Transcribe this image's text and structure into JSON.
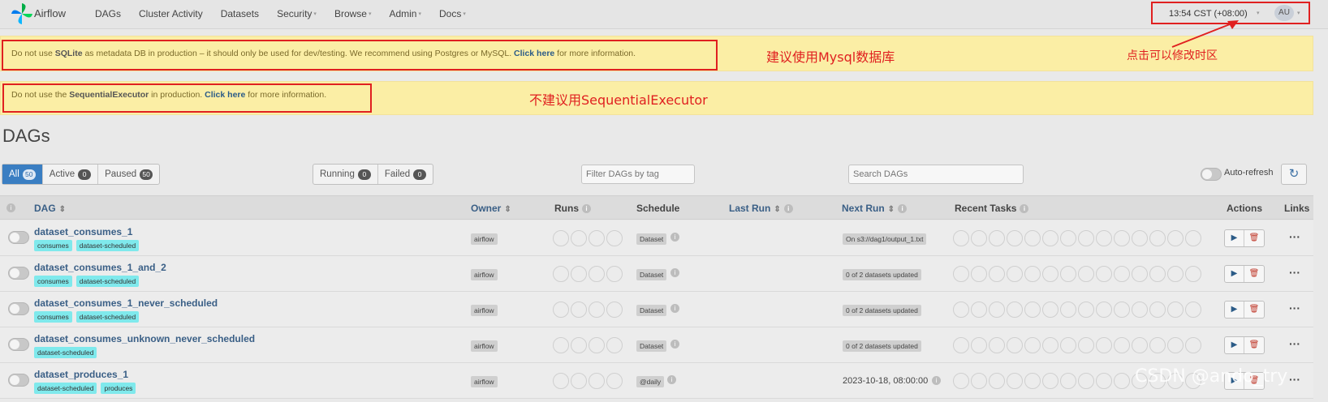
{
  "brand": "Airflow",
  "nav": [
    {
      "label": "DAGs",
      "dropdown": false
    },
    {
      "label": "Cluster Activity",
      "dropdown": false
    },
    {
      "label": "Datasets",
      "dropdown": false
    },
    {
      "label": "Security",
      "dropdown": true
    },
    {
      "label": "Browse",
      "dropdown": true
    },
    {
      "label": "Admin",
      "dropdown": true
    },
    {
      "label": "Docs",
      "dropdown": true
    }
  ],
  "time": "13:54 CST (+08:00)",
  "user_initials": "AU",
  "alerts": {
    "a1": {
      "pre": "Do not use ",
      "bold": "SQLite",
      "mid": " as metadata DB in production – it should only be used for dev/testing. We recommend using Postgres or MySQL. ",
      "link": "Click here",
      "post": " for more information."
    },
    "a2": {
      "pre": "Do not use the ",
      "bold": "SequentialExecutor",
      "mid": " in production. ",
      "link": "Click here",
      "post": " for more information."
    }
  },
  "annotations": {
    "mysql": "建议使用Mysql数据库",
    "timezone": "点击可以修改时区",
    "sequential": "不建议用SequentialExecutor"
  },
  "page_title": "DAGs",
  "filters": {
    "all": {
      "label": "All",
      "count": "50"
    },
    "active": {
      "label": "Active",
      "count": "0"
    },
    "paused": {
      "label": "Paused",
      "count": "50"
    },
    "running": {
      "label": "Running",
      "count": "0"
    },
    "failed": {
      "label": "Failed",
      "count": "0"
    }
  },
  "tag_filter_placeholder": "Filter DAGs by tag",
  "search_placeholder": "Search DAGs",
  "auto_refresh_label": "Auto-refresh",
  "columns": {
    "dag": "DAG",
    "owner": "Owner",
    "runs": "Runs",
    "schedule": "Schedule",
    "last_run": "Last Run",
    "next_run": "Next Run",
    "recent_tasks": "Recent Tasks",
    "actions": "Actions",
    "links": "Links"
  },
  "rows": [
    {
      "name": "dataset_consumes_1",
      "tags": [
        "consumes",
        "dataset-scheduled"
      ],
      "owner": "airflow",
      "schedule": "Dataset",
      "next_run": "On s3://dag1/output_1.txt",
      "next_run_pill": true
    },
    {
      "name": "dataset_consumes_1_and_2",
      "tags": [
        "consumes",
        "dataset-scheduled"
      ],
      "owner": "airflow",
      "schedule": "Dataset",
      "next_run": "0 of 2 datasets updated",
      "next_run_pill": true
    },
    {
      "name": "dataset_consumes_1_never_scheduled",
      "tags": [
        "consumes",
        "dataset-scheduled"
      ],
      "owner": "airflow",
      "schedule": "Dataset",
      "next_run": "0 of 2 datasets updated",
      "next_run_pill": true
    },
    {
      "name": "dataset_consumes_unknown_never_scheduled",
      "tags": [
        "dataset-scheduled"
      ],
      "owner": "airflow",
      "schedule": "Dataset",
      "next_run": "0 of 2 datasets updated",
      "next_run_pill": true
    },
    {
      "name": "dataset_produces_1",
      "tags": [
        "dataset-scheduled",
        "produces"
      ],
      "owner": "airflow",
      "schedule": "@daily",
      "next_run": "2023-10-18, 08:00:00",
      "next_run_pill": false
    }
  ],
  "watermark": "CSDN @ando_try"
}
